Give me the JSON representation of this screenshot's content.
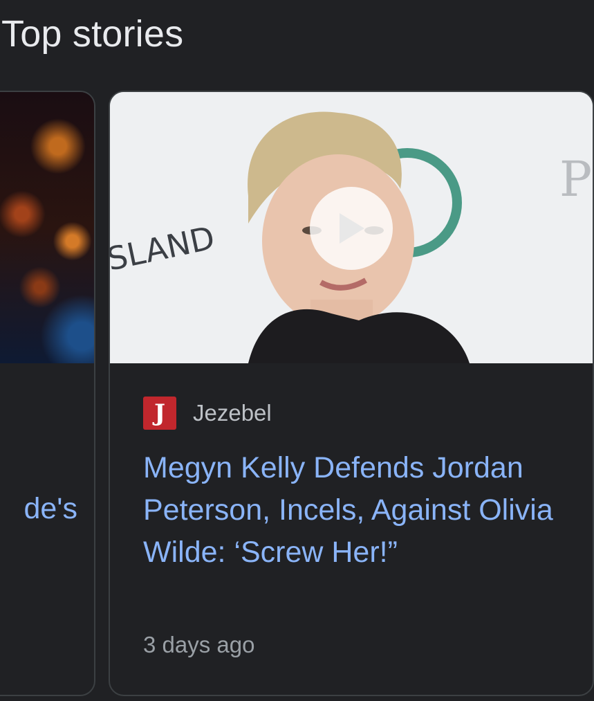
{
  "section": {
    "title": "Top stories"
  },
  "cards": [
    {
      "headline_fragment": "de's"
    },
    {
      "source": "Jezebel",
      "source_logo_letter": "J",
      "headline": "Megyn Kelly Defends Jordan Peterson, Incels, Against Olivia Wilde: ‘Screw Her!”",
      "timestamp": "3 days ago",
      "thumbnail_signage": "SLAND",
      "has_video": true
    }
  ],
  "colors": {
    "background": "#202124",
    "link": "#8ab4f8",
    "source_logo": "#c1272d"
  },
  "icons": {
    "play": "play-icon"
  }
}
